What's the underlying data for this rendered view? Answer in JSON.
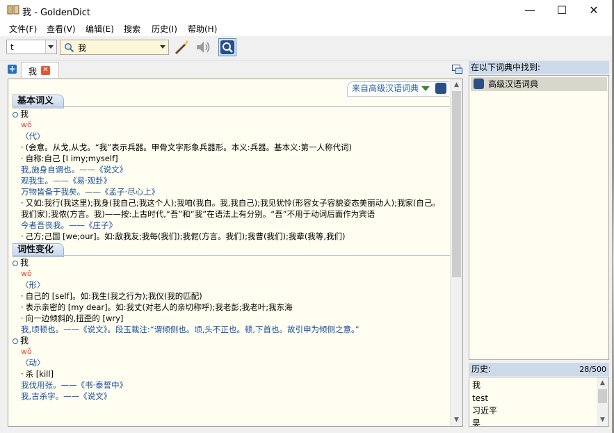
{
  "window": {
    "title": "我 - GoldenDict",
    "min": "—",
    "max": "☐",
    "close": "✕"
  },
  "menu": [
    "文件(F)",
    "查看(V)",
    "编辑(E)",
    "搜索",
    "历史(I)",
    "帮助(H)"
  ],
  "toolbar": {
    "group_value": "t",
    "search_value": "我"
  },
  "tabs": [
    {
      "label": "我"
    }
  ],
  "article": {
    "dict_header": "来自高级汉语词典",
    "sections": [
      {
        "title": "基本词义",
        "lines": [
          {
            "k": "head",
            "t": "我"
          },
          {
            "k": "pin",
            "t": "wǒ"
          },
          {
            "k": "pos",
            "t": "〈代〉"
          },
          {
            "k": "def",
            "t": "(会意。从戈,从戈。“我”表示兵器。甲骨文字形象兵器形。本义:兵器。基本义:第一人称代词)"
          },
          {
            "k": "def",
            "t": "自称:自己 [I imy;myself]"
          },
          {
            "k": "quote",
            "t": "我,施身自谓也。——《说文》"
          },
          {
            "k": "quote",
            "t": "观我生。——《易·观卦》"
          },
          {
            "k": "quote",
            "t": "万物皆备于我矣。——《孟子·尽心上》"
          },
          {
            "k": "defw",
            "t": "又如:我行(我这里);我身(我自己;我这个人);我咱(我自。我,我自己);我见犹怜(形容女子容貌姿态美丽动人);我家(自己。我们家);我侬(方言。我)——按:上古时代,“吾”和“我”在语法上有分别。“吾”不用于动词后面作为宾语"
          },
          {
            "k": "quote",
            "t": "今者吾丧我。——《庄子》"
          },
          {
            "k": "def",
            "t": "己方;己国 [we;our]。如:敌我友;我每(我们);我伲(方言。我们);我曹(我们);我辈(我等,我们)"
          }
        ]
      },
      {
        "title": "词性变化",
        "lines": [
          {
            "k": "head",
            "t": "我"
          },
          {
            "k": "pin",
            "t": "wǒ"
          },
          {
            "k": "pos",
            "t": "〈形〉"
          },
          {
            "k": "def",
            "t": "自己的 [self]。如:我生(我之行为);我仪(我的匹配)"
          },
          {
            "k": "def",
            "t": "表示亲密的 [my dear]。如:我丈(对老人的亲切称呼);我老彭;我老叶;我东海"
          },
          {
            "k": "def",
            "t": "向一边倾斜的,扭歪的 [wry]"
          },
          {
            "k": "quote",
            "t": "我,顷顿也。——《说文》。段玉裁注:“谓倾侧也。顷,头不正也。顿,下首也。故引申为倾侧之意。”"
          },
          {
            "k": "head",
            "t": "我"
          },
          {
            "k": "pin",
            "t": "wǒ"
          },
          {
            "k": "pos",
            "t": "〈动〉"
          },
          {
            "k": "def",
            "t": "杀 [kill]"
          },
          {
            "k": "quote",
            "t": "我伐用张。——《书·泰誓中》"
          },
          {
            "k": "quote",
            "t": "我,古杀字。——《说文》"
          }
        ]
      }
    ]
  },
  "found": {
    "title": "在以下词典中找到:",
    "items": [
      "高级汉语词典"
    ]
  },
  "history": {
    "title": "历史:",
    "count": "28/500",
    "items": [
      "我",
      "test",
      "习近平",
      "昊"
    ]
  }
}
